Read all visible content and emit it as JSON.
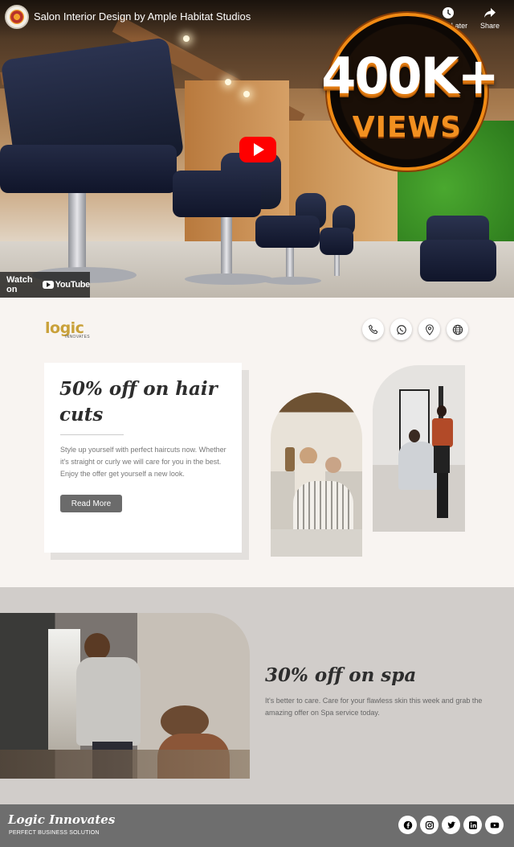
{
  "video": {
    "title": "Salon Interior Design by Ample Habitat Studios",
    "watch_later_label": "Watch Later",
    "share_label": "Share",
    "watch_on_label": "Watch on",
    "youtube_label": "YouTube",
    "views_big": "400K+",
    "views_small": "VIEWS"
  },
  "header": {
    "logo_word": "logic",
    "logo_sub": "INNOVATES",
    "contact_icons": [
      "phone-icon",
      "whatsapp-icon",
      "location-icon",
      "globe-icon"
    ]
  },
  "offer": {
    "title": "50% off on hair cuts",
    "body": "Style up yourself with perfect haircuts now. Whether it's straight or curly we will care for you in the best. Enjoy the offer get yourself a new look.",
    "button_label": "Read More"
  },
  "spa": {
    "title": "30% off on spa",
    "body": "It's better to care. Care for your flawless skin this week and grab the amazing offer on Spa service today."
  },
  "footer": {
    "brand": "Logic Innovates",
    "tagline": "PERFECT BUSINESS SOLUTION",
    "social": [
      "facebook-icon",
      "instagram-icon",
      "twitter-icon",
      "linkedin-icon",
      "youtube-icon"
    ]
  },
  "colors": {
    "brand_gold": "#c9a13a",
    "badge_orange": "#f08a14",
    "youtube_red": "#ff0000",
    "button_gray": "#6b6b6b",
    "footer_gray": "#6e6e6e"
  }
}
